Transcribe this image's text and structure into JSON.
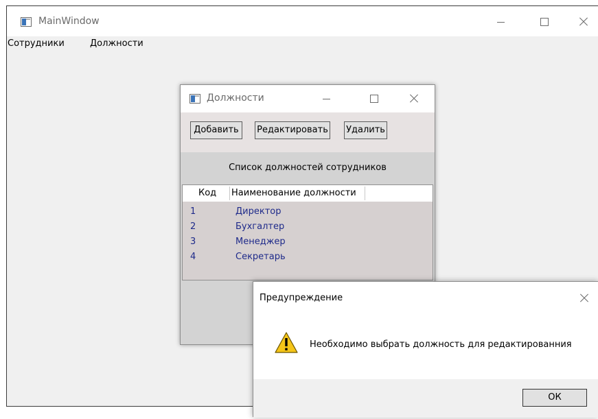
{
  "main_window": {
    "title": "MainWindow",
    "menu": [
      "Сотрудники",
      "Должности"
    ]
  },
  "positions_window": {
    "title": "Должности",
    "toolbar": {
      "add": "Добавить",
      "edit": "Редактировать",
      "delete": "Удалить"
    },
    "list_title": "Список должностей сотрудников",
    "columns": [
      "Код",
      "Наименование должности"
    ],
    "rows": [
      {
        "code": "1",
        "name": "Директор"
      },
      {
        "code": "2",
        "name": "Бухгалтер"
      },
      {
        "code": "3",
        "name": "Менеджер"
      },
      {
        "code": "4",
        "name": "Секретарь"
      }
    ]
  },
  "message_box": {
    "title": "Предупреждение",
    "message": "Необходимо выбрать должность для редактированния",
    "ok": "ОК",
    "icon": "warning-icon"
  },
  "colors": {
    "row_text": "#1e2a8a",
    "window_bg": "#f0f0f0",
    "grid_bg": "#d6d0d0"
  }
}
